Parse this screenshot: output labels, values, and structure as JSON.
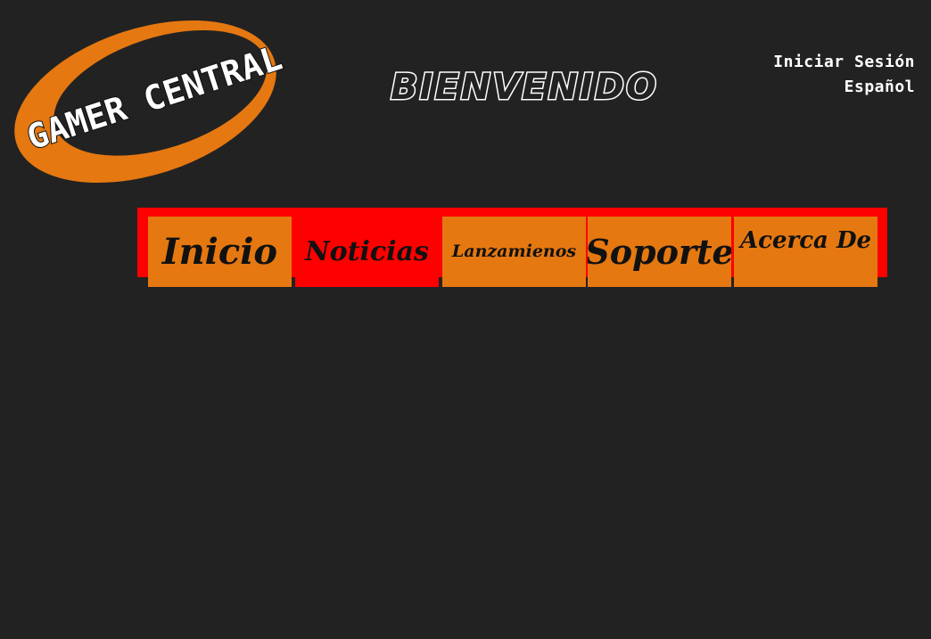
{
  "logo": {
    "text": "GAMER CENTRAL",
    "ring_color": "#e57811"
  },
  "header": {
    "welcome": "BIENVENIDO"
  },
  "top_links": {
    "login": "Iniciar Sesión",
    "language": "Español"
  },
  "nav": {
    "bar_color": "#ff0000",
    "tab_color": "#e57811",
    "items": [
      {
        "label": "Inicio",
        "active": false
      },
      {
        "label": "Noticias",
        "active": true
      },
      {
        "label": "Lanzamienos",
        "active": false
      },
      {
        "label": "Soporte",
        "active": false
      },
      {
        "label": "Acerca De",
        "active": false
      }
    ]
  },
  "colors": {
    "background": "#222222"
  }
}
